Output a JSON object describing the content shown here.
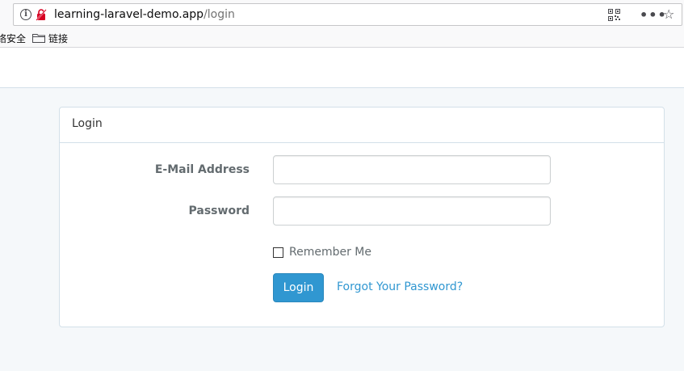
{
  "browser": {
    "url_host": "learning-laravel-demo.app",
    "url_path": "/login",
    "more_glyph": "•••",
    "star_glyph": "☆",
    "info_glyph": "i",
    "bookmarks": [
      {
        "label": "络安全"
      },
      {
        "label": "链接"
      }
    ]
  },
  "panel": {
    "title": "Login"
  },
  "form": {
    "email_label": "E-Mail Address",
    "email_value": "",
    "password_label": "Password",
    "password_value": "",
    "remember_label": "Remember Me",
    "login_button": "Login",
    "forgot_link": "Forgot Your Password?"
  },
  "colors": {
    "primary": "#3097d1",
    "background": "#f5f8fa",
    "border": "#d3e0e9"
  }
}
